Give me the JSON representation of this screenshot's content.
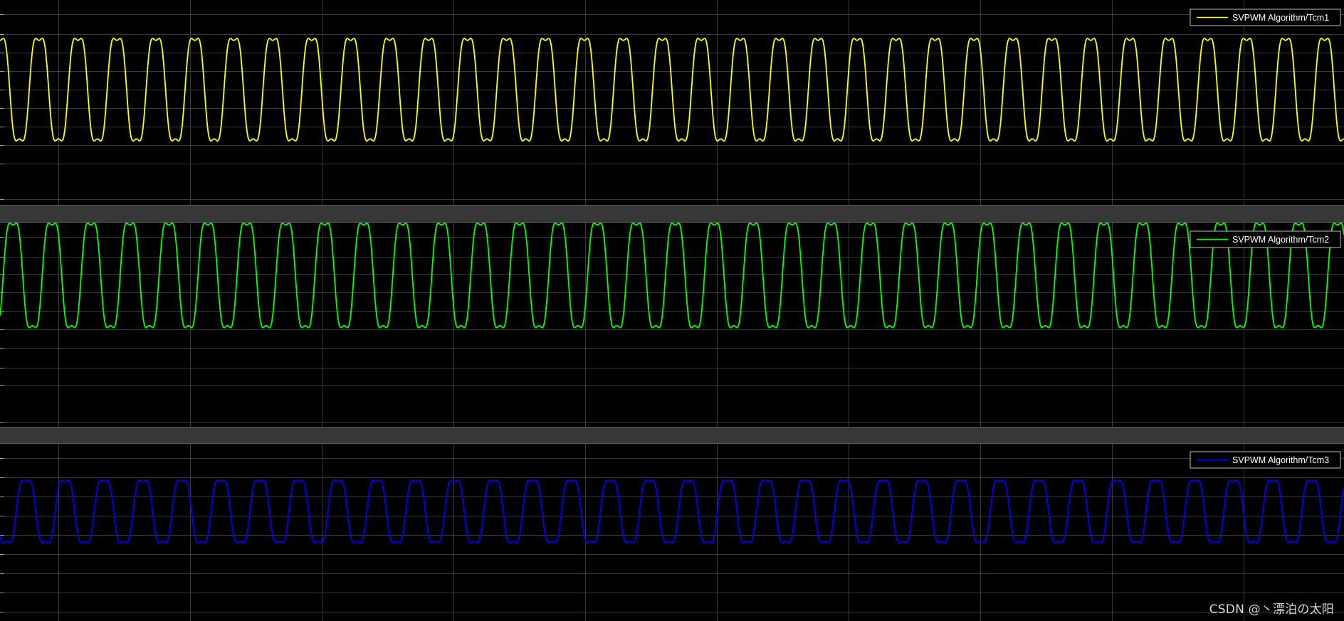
{
  "colors": {
    "background": "#000000",
    "grid": "#3a3a3a",
    "separator": "#373737",
    "legend_border": "#bfbfbf",
    "legend_text": "#ffffff"
  },
  "watermark": "CSDN @丶漂泊の太阳",
  "chart_data": [
    {
      "type": "line",
      "legend_position": "top-right",
      "grid": true,
      "ylim": [
        -1.2,
        1.2
      ],
      "period_cycles": 34.5,
      "phase_deg": 0,
      "series": [
        {
          "name": "SVPWM Algorithm/Tcm1",
          "color": "#ffff00",
          "shape": "saddle-topped triangle (third-harmonic injected sine)",
          "peak": 1.0,
          "trough": -1.0
        }
      ]
    },
    {
      "type": "line",
      "legend_position": "top-right",
      "grid": true,
      "ylim": [
        -1.2,
        1.2
      ],
      "period_cycles": 34.5,
      "phase_deg": -120,
      "series": [
        {
          "name": "SVPWM Algorithm/Tcm2",
          "color": "#00ff00",
          "shape": "saddle-topped triangle (third-harmonic injected sine)",
          "peak": 1.0,
          "trough": -1.0
        }
      ]
    },
    {
      "type": "line",
      "legend_position": "top-right",
      "grid": true,
      "ylim": [
        -1.55,
        1.2
      ],
      "period_cycles": 34.5,
      "phase_deg": 120,
      "series": [
        {
          "name": "SVPWM Algorithm/Tcm3",
          "color": "#0000ff",
          "shape": "saddle-topped triangle (third-harmonic injected sine)",
          "peak": 0.72,
          "trough": -0.72
        }
      ]
    }
  ]
}
